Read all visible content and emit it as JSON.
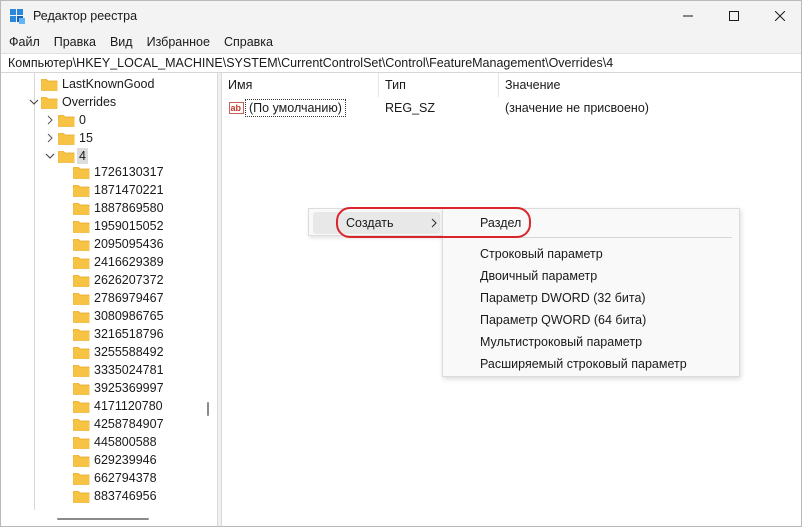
{
  "window": {
    "title": "Редактор реестра",
    "controls": [
      "minimize-icon",
      "maximize-icon",
      "close-icon"
    ]
  },
  "menu": [
    "Файл",
    "Правка",
    "Вид",
    "Избранное",
    "Справка"
  ],
  "address": "Компьютер\\HKEY_LOCAL_MACHINE\\SYSTEM\\CurrentControlSet\\Control\\FeatureManagement\\Overrides\\4",
  "tree": {
    "last_known_good": "LastKnownGood",
    "overrides": "Overrides",
    "children": [
      "0",
      "15",
      "4"
    ],
    "subkeys": [
      "1726130317",
      "1871470221",
      "1887869580",
      "1959015052",
      "2095095436",
      "2416629389",
      "2626207372",
      "2786979467",
      "3080986765",
      "3216518796",
      "3255588492",
      "3335024781",
      "3925369997",
      "4171120780",
      "4258784907",
      "445800588",
      "629239946",
      "662794378",
      "883746956"
    ]
  },
  "list": {
    "columns": [
      "Имя",
      "Тип",
      "Значение"
    ],
    "rows": [
      {
        "name": "(По умолчанию)",
        "type": "REG_SZ",
        "value": "(значение не присвоено)",
        "icon": "string-value-icon"
      }
    ]
  },
  "context_menu": {
    "item": "Создать",
    "submenu": {
      "first": "Раздел",
      "items": [
        "Строковый параметр",
        "Двоичный параметр",
        "Параметр DWORD (32 бита)",
        "Параметр QWORD (64 бита)",
        "Мультистроковый параметр",
        "Расширяемый строковый параметр"
      ]
    }
  },
  "colors": {
    "folder": "#f6c344",
    "folder_dark": "#e8a820",
    "highlight_oval": "#d9262b",
    "selection": "#dcdcdc"
  }
}
